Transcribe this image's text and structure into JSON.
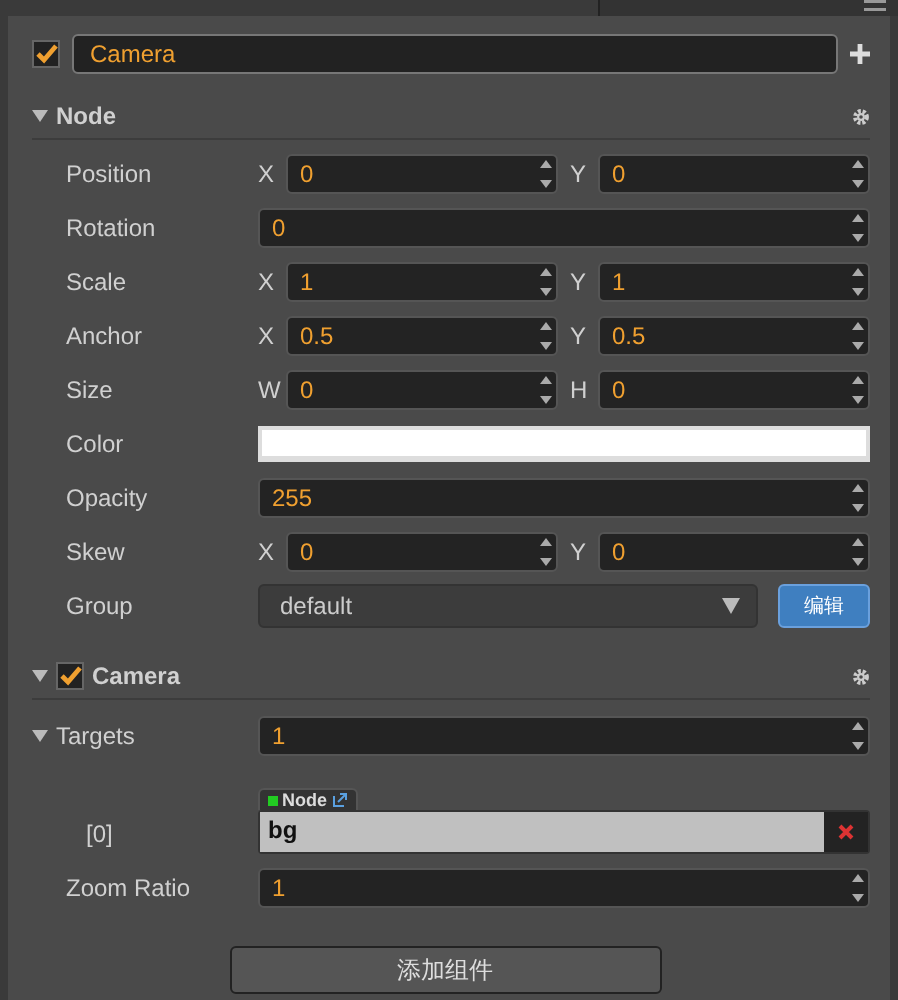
{
  "node_name": {
    "value": "Camera",
    "checked": true
  },
  "node_section": {
    "title": "Node",
    "expanded": true,
    "rows": [
      {
        "kind": "pair",
        "label": "Position",
        "a_label": "X",
        "a_value": "0",
        "b_label": "Y",
        "b_value": "0"
      },
      {
        "kind": "number",
        "label": "Rotation",
        "value": "0"
      },
      {
        "kind": "pair",
        "label": "Scale",
        "a_label": "X",
        "a_value": "1",
        "b_label": "Y",
        "b_value": "1"
      },
      {
        "kind": "pair",
        "label": "Anchor",
        "a_label": "X",
        "a_value": "0.5",
        "b_label": "Y",
        "b_value": "0.5"
      },
      {
        "kind": "size",
        "label": "Size",
        "a_label": "W",
        "a_value": "0",
        "b_label": "H",
        "b_value": "0"
      },
      {
        "kind": "color",
        "label": "Color",
        "color": "#ffffff"
      },
      {
        "kind": "number",
        "label": "Opacity",
        "value": "255"
      },
      {
        "kind": "pair",
        "label": "Skew",
        "a_label": "X",
        "a_value": "0",
        "b_label": "Y",
        "b_value": "0"
      },
      {
        "kind": "select",
        "label": "Group",
        "value": "default",
        "button": "编辑"
      }
    ]
  },
  "camera_section": {
    "title": "Camera",
    "checked": true,
    "expanded": true,
    "targets": {
      "label": "Targets",
      "expanded": true,
      "value": "1",
      "items": [
        {
          "index": "[0]",
          "type": "Node",
          "value": "bg"
        }
      ]
    },
    "zoom_ratio": {
      "label": "Zoom Ratio",
      "value": "1"
    }
  },
  "add_component_button": "添加组件"
}
